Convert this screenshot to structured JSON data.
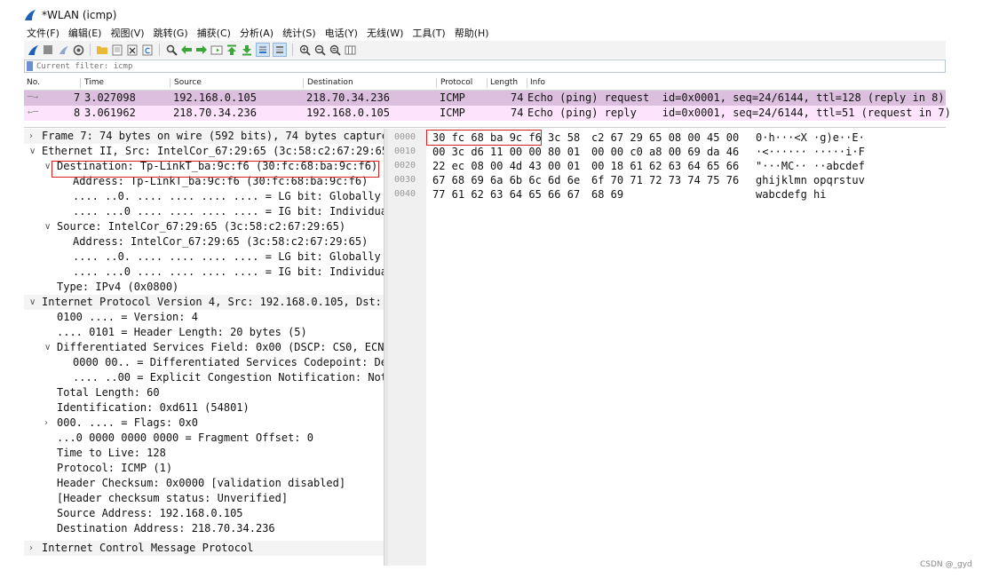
{
  "window": {
    "title": "*WLAN (icmp)"
  },
  "menu": [
    "文件(F)",
    "编辑(E)",
    "视图(V)",
    "跳转(G)",
    "捕获(C)",
    "分析(A)",
    "统计(S)",
    "电话(Y)",
    "无线(W)",
    "工具(T)",
    "帮助(H)"
  ],
  "filter": {
    "placeholder": "Current filter: icmp"
  },
  "packet_list": {
    "columns": [
      "No.",
      "Time",
      "Source",
      "Destination",
      "Protocol",
      "Length",
      "Info"
    ],
    "rows": [
      {
        "no": "7",
        "time": "3.027098",
        "source": "192.168.0.105",
        "destination": "218.70.34.236",
        "protocol": "ICMP",
        "length": "74",
        "info": "Echo (ping) request  id=0x0001, seq=24/6144, ttl=128 (reply in 8)"
      },
      {
        "no": "8",
        "time": "3.061962",
        "source": "218.70.34.236",
        "destination": "192.168.0.105",
        "protocol": "ICMP",
        "length": "74",
        "info": "Echo (ping) reply    id=0x0001, seq=24/6144, ttl=51 (request in 7)"
      }
    ]
  },
  "details": [
    {
      "toggle": ">",
      "text": "Frame 7: 74 bytes on wire (592 bits), 74 bytes capture"
    },
    {
      "toggle": "v",
      "text": "Ethernet II, Src: IntelCor_67:29:65 (3c:58:c2:67:29:65"
    },
    {
      "toggle": "v",
      "text": "Destination: Tp-LinkT_ba:9c:f6 (30:fc:68:ba:9c:f6)"
    },
    {
      "toggle": "",
      "text": "Address: Tp-LinkT_ba:9c:f6 (30:fc:68:ba:9c:f6)"
    },
    {
      "toggle": "",
      "text": ".... ..0. .... .... .... .... = LG bit: Globally"
    },
    {
      "toggle": "",
      "text": ".... ...0 .... .... .... .... = IG bit: Individua"
    },
    {
      "toggle": "v",
      "text": "Source: IntelCor_67:29:65 (3c:58:c2:67:29:65)"
    },
    {
      "toggle": "",
      "text": "Address: IntelCor_67:29:65 (3c:58:c2:67:29:65)"
    },
    {
      "toggle": "",
      "text": ".... ..0. .... .... .... .... = LG bit: Globally"
    },
    {
      "toggle": "",
      "text": ".... ...0 .... .... .... .... = IG bit: Individua"
    },
    {
      "toggle": "",
      "text": "Type: IPv4 (0x0800)"
    },
    {
      "toggle": "v",
      "text": "Internet Protocol Version 4, Src: 192.168.0.105, Dst:"
    },
    {
      "toggle": "",
      "text": "0100 .... = Version: 4"
    },
    {
      "toggle": "",
      "text": ".... 0101 = Header Length: 20 bytes (5)"
    },
    {
      "toggle": "v",
      "text": "Differentiated Services Field: 0x00 (DSCP: CS0, ECN"
    },
    {
      "toggle": "",
      "text": "0000 00.. = Differentiated Services Codepoint: De"
    },
    {
      "toggle": "",
      "text": ".... ..00 = Explicit Congestion Notification: Not"
    },
    {
      "toggle": "",
      "text": "Total Length: 60"
    },
    {
      "toggle": "",
      "text": "Identification: 0xd611 (54801)"
    },
    {
      "toggle": ">",
      "text": "000. .... = Flags: 0x0"
    },
    {
      "toggle": "",
      "text": "...0 0000 0000 0000 = Fragment Offset: 0"
    },
    {
      "toggle": "",
      "text": "Time to Live: 128"
    },
    {
      "toggle": "",
      "text": "Protocol: ICMP (1)"
    },
    {
      "toggle": "",
      "text": "Header Checksum: 0x0000 [validation disabled]"
    },
    {
      "toggle": "",
      "text": "[Header checksum status: Unverified]"
    },
    {
      "toggle": "",
      "text": "Source Address: 192.168.0.105"
    },
    {
      "toggle": "",
      "text": "Destination Address: 218.70.34.236"
    },
    {
      "toggle": ">",
      "text": "Internet Control Message Protocol"
    }
  ],
  "bytes": [
    {
      "offset": "0000",
      "hex1": "30 fc 68 ba 9c f6 3c 58",
      "hex2": "c2 67 29 65 08 00 45 00",
      "ascii": "0·h···<X ·g)e··E·"
    },
    {
      "offset": "0010",
      "hex1": "00 3c d6 11 00 00 80 01",
      "hex2": "00 00 c0 a8 00 69 da 46",
      "ascii": "·<······ ·····i·F"
    },
    {
      "offset": "0020",
      "hex1": "22 ec 08 00 4d 43 00 01",
      "hex2": "00 18 61 62 63 64 65 66",
      "ascii": "\"···MC·· ··abcdef"
    },
    {
      "offset": "0030",
      "hex1": "67 68 69 6a 6b 6c 6d 6e",
      "hex2": "6f 70 71 72 73 74 75 76",
      "ascii": "ghijklmn opqrstuv"
    },
    {
      "offset": "0040",
      "hex1": "77 61 62 63 64 65 66 67",
      "hex2": "68 69",
      "ascii": "wabcdefg hi"
    }
  ],
  "watermark": "CSDN @_gyd",
  "colors": {
    "selected_row": "#dcbfdf",
    "other_row": "#fde4fc",
    "highlight_box": "#d62020"
  }
}
